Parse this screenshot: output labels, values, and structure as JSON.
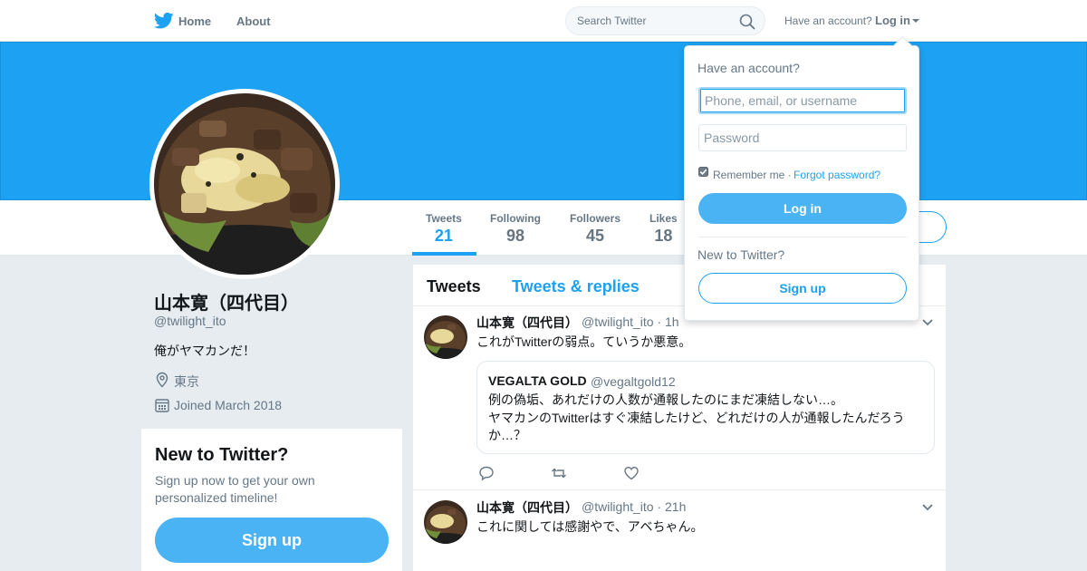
{
  "nav": {
    "home_label": "Home",
    "about_label": "About",
    "search_placeholder": "Search Twitter",
    "have_account": "Have an account?",
    "login_label": "Log in"
  },
  "stats": [
    {
      "label": "Tweets",
      "value": "21"
    },
    {
      "label": "Following",
      "value": "98"
    },
    {
      "label": "Followers",
      "value": "45"
    },
    {
      "label": "Likes",
      "value": "18"
    }
  ],
  "profile": {
    "name": "山本寛（四代目）",
    "handle": "@twilight_ito",
    "bio": "俺がヤマカンだ！",
    "location": "東京",
    "joined": "Joined March 2018"
  },
  "signup_box": {
    "title": "New to Twitter?",
    "description": "Sign up now to get your own personalized timeline!",
    "button": "Sign up"
  },
  "timeline": {
    "tabs": [
      "Tweets",
      "Tweets & replies"
    ],
    "tweets": [
      {
        "name": "山本寛（四代目）",
        "handle": "@twilight_ito · 1h",
        "text": "これがTwitterの弱点。ていうか悪意。",
        "quote": {
          "name": "VEGALTA GOLD",
          "handle": "@vegaltgold12",
          "text": "例の偽垢、あれだけの人数が通報したのにまだ凍結しない…。\nヤマカンのTwitterはすぐ凍結したけど、どれだけの人が通報したんだろうか…？"
        }
      },
      {
        "name": "山本寛（四代目）",
        "handle": "@twilight_ito · 21h",
        "text": "これに関しては感謝やで、アベちゃん。"
      }
    ]
  },
  "login_dropdown": {
    "title": "Have an account?",
    "username_placeholder": "Phone, email, or username",
    "password_placeholder": "Password",
    "remember_me": "Remember me ·",
    "forgot_password": "Forgot password?",
    "login_button": "Log in",
    "new_to_twitter": "New to Twitter?",
    "signup_button": "Sign up"
  },
  "colors": {
    "brand_blue": "#1da1f2",
    "button_blue": "#4ab3f4",
    "muted_text": "#657786"
  }
}
